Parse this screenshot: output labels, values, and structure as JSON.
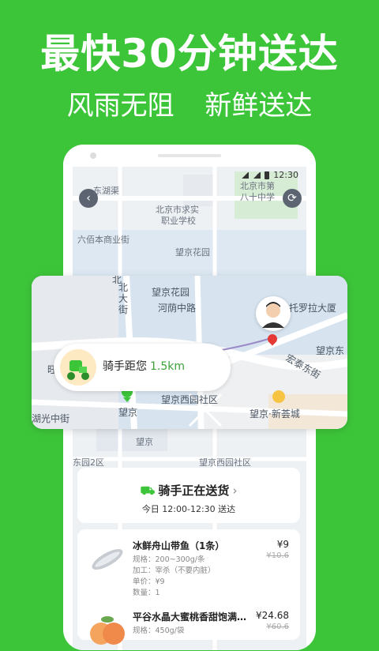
{
  "promo": {
    "headline": "最快30分钟送达",
    "sub_left": "风雨无阻",
    "sub_right": "新鲜送达"
  },
  "status_bar": {
    "time": "12:30"
  },
  "bg_map_labels": {
    "l1": "东湖渠",
    "l2": "北京市求实",
    "l3": "职业学校",
    "l4": "北京市第",
    "l5": "八十中学",
    "l6": "六佰本商业街",
    "l7": "望京花园",
    "l8": "望京",
    "l9": "东园2区",
    "l10": "望京西园社区",
    "l11": "望京"
  },
  "popup_map": {
    "labels": {
      "a": "北",
      "b": "顺",
      "c": "北",
      "d": "大",
      "e": "街",
      "f": "望京花园",
      "g": "河荫中路",
      "h": "托罗拉大厦",
      "i": "望京东",
      "j": "宏泰东街",
      "k": "街",
      "l": "望京西园社区",
      "m": "望京·新荟城",
      "n": "望京",
      "o": "湖光中街",
      "p": "旺"
    },
    "rider_label": "骑手距您",
    "rider_distance": "1.5km"
  },
  "delivery": {
    "title": "骑手正在送货",
    "chevron": "›",
    "time": "今日 12:00-12:30 送达"
  },
  "items": [
    {
      "name": "冰鲜舟山带鱼（1条）",
      "price": "¥9",
      "orig_price": "¥10.6",
      "spec": "规格：200~300g/条",
      "process": "加工：宰杀（不要内脏）",
      "unit": "单价：¥9",
      "qty": "数量：1"
    },
    {
      "name": "平谷水晶大蜜桃香甜饱满…",
      "price": "¥24.68",
      "orig_price": "¥60.6",
      "spec": "规格：450g/袋"
    }
  ]
}
